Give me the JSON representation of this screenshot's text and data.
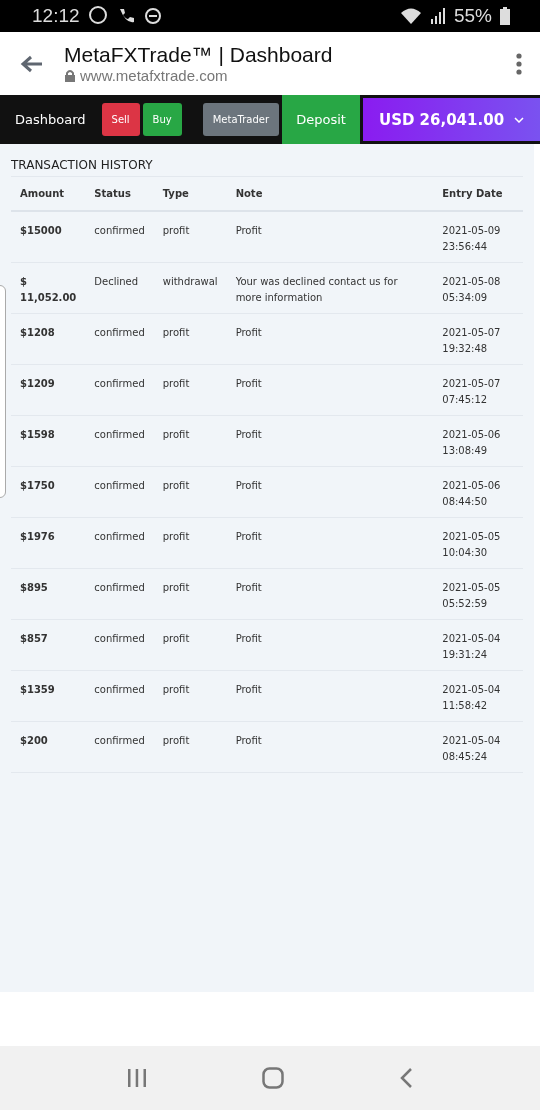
{
  "status_bar": {
    "time": "12:12",
    "battery": "55%"
  },
  "browser": {
    "title": "MetaFXTrade™ | Dashboard",
    "url": "www.metafxtrade.com"
  },
  "nav": {
    "label": "Dashboard",
    "buttons": [
      {
        "label": "Sell",
        "kind": "danger"
      },
      {
        "label": "Buy",
        "kind": "success"
      },
      {
        "label": "MetaTrader",
        "kind": "secondary"
      }
    ],
    "deposit": "Deposit",
    "balance": "USD 26,041.00"
  },
  "table": {
    "title": "TRANSACTION HISTORY",
    "columns": [
      "Amount",
      "Status",
      "Type",
      "Note",
      "Entry Date"
    ],
    "rows": [
      {
        "amount": "$15000",
        "status": "confirmed",
        "type": "profit",
        "note": "Profit",
        "date": "2021-05-09 23:56:44"
      },
      {
        "amount": "$ 11,052.00",
        "status": "Declined",
        "type": "withdrawal",
        "note": "Your was declined contact us for more information",
        "date": "2021-05-08 05:34:09"
      },
      {
        "amount": "$1208",
        "status": "confirmed",
        "type": "profit",
        "note": "Profit",
        "date": "2021-05-07 19:32:48"
      },
      {
        "amount": "$1209",
        "status": "confirmed",
        "type": "profit",
        "note": "Profit",
        "date": "2021-05-07 07:45:12"
      },
      {
        "amount": "$1598",
        "status": "confirmed",
        "type": "profit",
        "note": "Profit",
        "date": "2021-05-06 13:08:49"
      },
      {
        "amount": "$1750",
        "status": "confirmed",
        "type": "profit",
        "note": "Profit",
        "date": "2021-05-06 08:44:50"
      },
      {
        "amount": "$1976",
        "status": "confirmed",
        "type": "profit",
        "note": "Profit",
        "date": "2021-05-05 10:04:30"
      },
      {
        "amount": "$895",
        "status": "confirmed",
        "type": "profit",
        "note": "Profit",
        "date": "2021-05-05 05:52:59"
      },
      {
        "amount": "$857",
        "status": "confirmed",
        "type": "profit",
        "note": "Profit",
        "date": "2021-05-04 19:31:24"
      },
      {
        "amount": "$1359",
        "status": "confirmed",
        "type": "profit",
        "note": "Profit",
        "date": "2021-05-04 11:58:42"
      },
      {
        "amount": "$200",
        "status": "confirmed",
        "type": "profit",
        "note": "Profit",
        "date": "2021-05-04 08:45:24"
      }
    ]
  }
}
